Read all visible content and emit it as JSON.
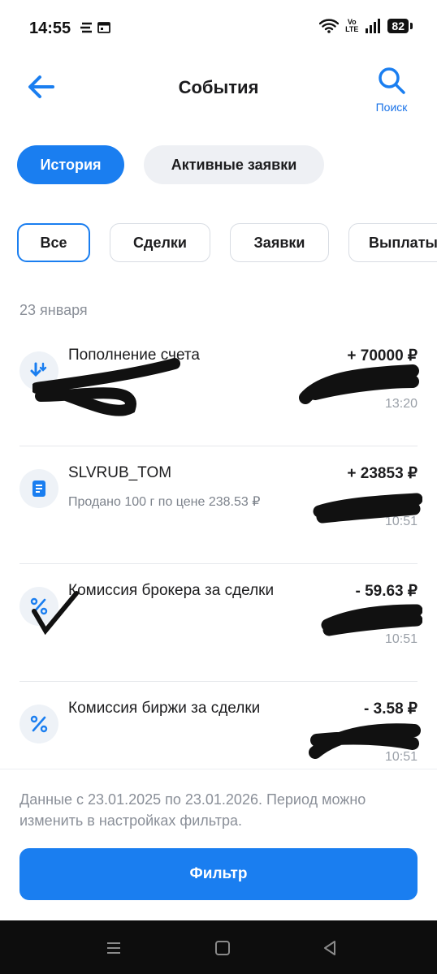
{
  "status": {
    "time": "14:55",
    "volte_top": "Vo",
    "volte_bottom": "LTE",
    "battery": "82"
  },
  "header": {
    "title": "События",
    "search_label": "Поиск"
  },
  "tabs": [
    {
      "label": "История"
    },
    {
      "label": "Активные заявки"
    }
  ],
  "chips": [
    {
      "label": "Все"
    },
    {
      "label": "Сделки"
    },
    {
      "label": "Заявки"
    },
    {
      "label": "Выплаты"
    }
  ],
  "date_header": "23 января",
  "events": [
    {
      "icon": "deposit-arrows-icon",
      "title": "Пополнение счета",
      "subtitle": "",
      "amount": "+ 70000 ₽",
      "time": "13:20"
    },
    {
      "icon": "document-icon",
      "title": "SLVRUB_TOM",
      "subtitle": "Продано 100 г по цене 238.53 ₽",
      "amount": "+ 23853 ₽",
      "time": "10:51"
    },
    {
      "icon": "percent-icon",
      "title": "Комиссия брокера за сделки",
      "subtitle": "",
      "amount": "- 59.63 ₽",
      "time": "10:51"
    },
    {
      "icon": "percent-icon",
      "title": "Комиссия биржи за сделки",
      "subtitle": "",
      "amount": "- 3.58 ₽",
      "time": "10:51"
    }
  ],
  "footer": {
    "note": "Данные с 23.01.2025 по 23.01.2026. Период можно изменить в настройках фильтра.",
    "filter_label": "Фильтр"
  },
  "colors": {
    "accent": "#1a7ef0",
    "secondary_text": "#8a8f98"
  }
}
